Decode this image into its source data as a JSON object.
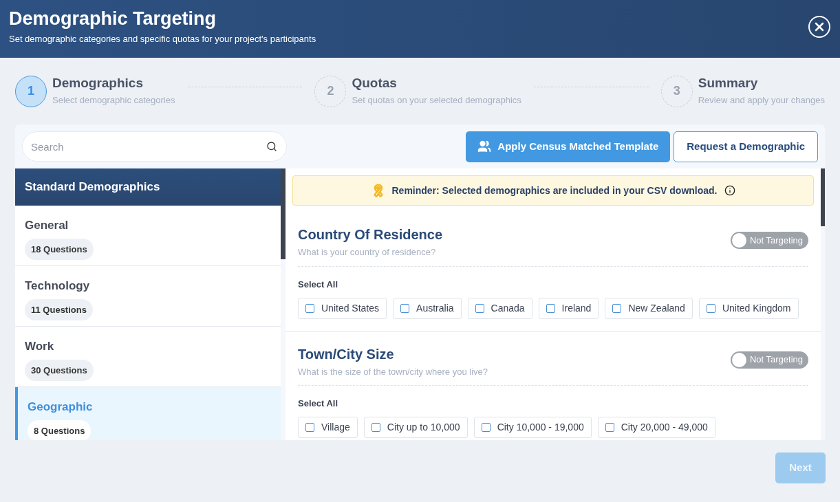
{
  "header": {
    "title": "Demographic Targeting",
    "subtitle": "Set demographic categories and specific quotas for your project's participants"
  },
  "steps": [
    {
      "number": "1",
      "title": "Demographics",
      "description": "Select demographic categories",
      "selected": true
    },
    {
      "number": "2",
      "title": "Quotas",
      "description": "Set quotas on your selected demographics",
      "selected": false
    },
    {
      "number": "3",
      "title": "Summary",
      "description": "Review and apply your changes",
      "selected": false
    }
  ],
  "search": {
    "placeholder": "Search"
  },
  "actions": {
    "primary": "Apply Census Matched Template",
    "secondary": "Request a Demographic"
  },
  "sidebar": {
    "title": "Standard Demographics",
    "items": [
      {
        "name": "General",
        "count": "18 Questions",
        "selected": false
      },
      {
        "name": "Technology",
        "count": "11 Questions",
        "selected": false
      },
      {
        "name": "Work",
        "count": "30 Questions",
        "selected": false
      },
      {
        "name": "Geographic",
        "count": "8 Questions",
        "selected": true
      }
    ]
  },
  "reminder": "Reminder: Selected demographics are included in your CSV download.",
  "questions": [
    {
      "title": "Country Of Residence",
      "prompt": "What is your country of residence?",
      "toggle": {
        "label": "Not Targeting",
        "on": false
      },
      "select_all": "Select All",
      "options": [
        {
          "label": "United States",
          "checked": false
        },
        {
          "label": "Australia",
          "checked": false
        },
        {
          "label": "Canada",
          "checked": false
        },
        {
          "label": "Ireland",
          "checked": false
        },
        {
          "label": "New Zealand",
          "checked": false
        },
        {
          "label": "United Kingdom",
          "checked": false
        }
      ]
    },
    {
      "title": "Town/City Size",
      "prompt": "What is the size of the town/city where you live?",
      "toggle": {
        "label": "Not Targeting",
        "on": false
      },
      "select_all": "Select All",
      "options": [
        {
          "label": "Village",
          "checked": false
        },
        {
          "label": "City up to 10,000",
          "checked": false
        },
        {
          "label": "City 10,000 - 19,000",
          "checked": false
        },
        {
          "label": "City 20,000 - 49,000",
          "checked": false
        }
      ]
    }
  ],
  "footer": {
    "next": {
      "label": "Next",
      "disabled": true
    }
  }
}
